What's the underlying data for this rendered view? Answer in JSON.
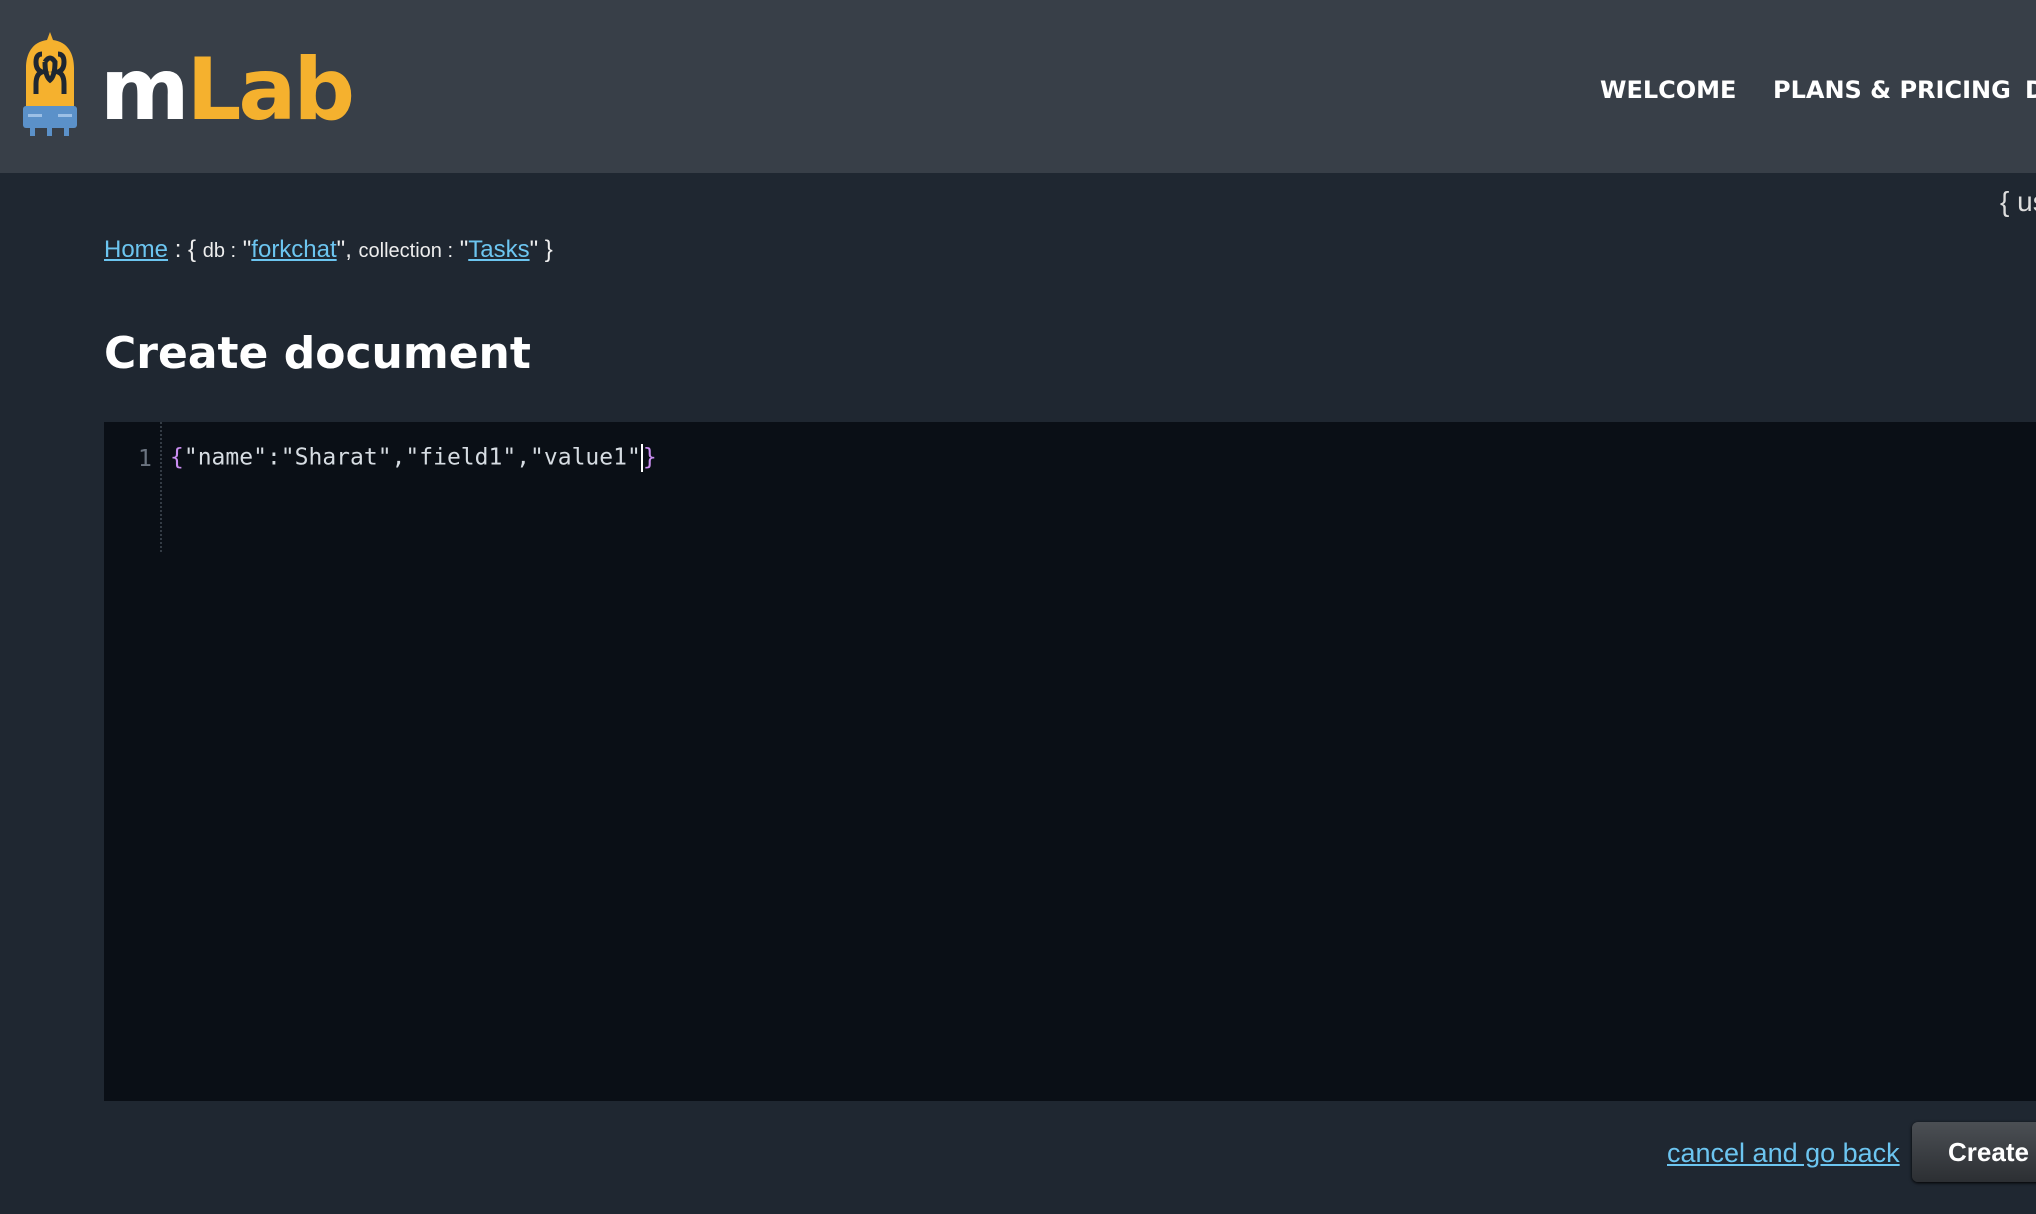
{
  "header": {
    "logo": {
      "part1": "m",
      "part2": "Lab"
    },
    "nav": [
      {
        "label": "WELCOME"
      },
      {
        "label": "PLANS & PRICING"
      },
      {
        "label": "D"
      }
    ],
    "user_fragment": "{ us"
  },
  "breadcrumb": {
    "home": "Home",
    "open": ": {",
    "db_key": "db :",
    "db_value": "forkchat",
    "sep": "\",",
    "collection_key": "collection :",
    "collection_value": "Tasks",
    "close": "\" }",
    "quote": "\""
  },
  "page": {
    "title": "Create document"
  },
  "editor": {
    "line_number": "1",
    "open_brace": "{",
    "content": "\"name\":\"Sharat\",\"field1\",\"value1\"",
    "close_brace": "}"
  },
  "actions": {
    "cancel": "cancel and go back",
    "create": "Create and go back"
  },
  "colors": {
    "header_bg": "#383f48",
    "body_bg": "#1f2731",
    "editor_bg": "#0a0f16",
    "link": "#6cc5f0",
    "brand": "#f5b12e"
  }
}
